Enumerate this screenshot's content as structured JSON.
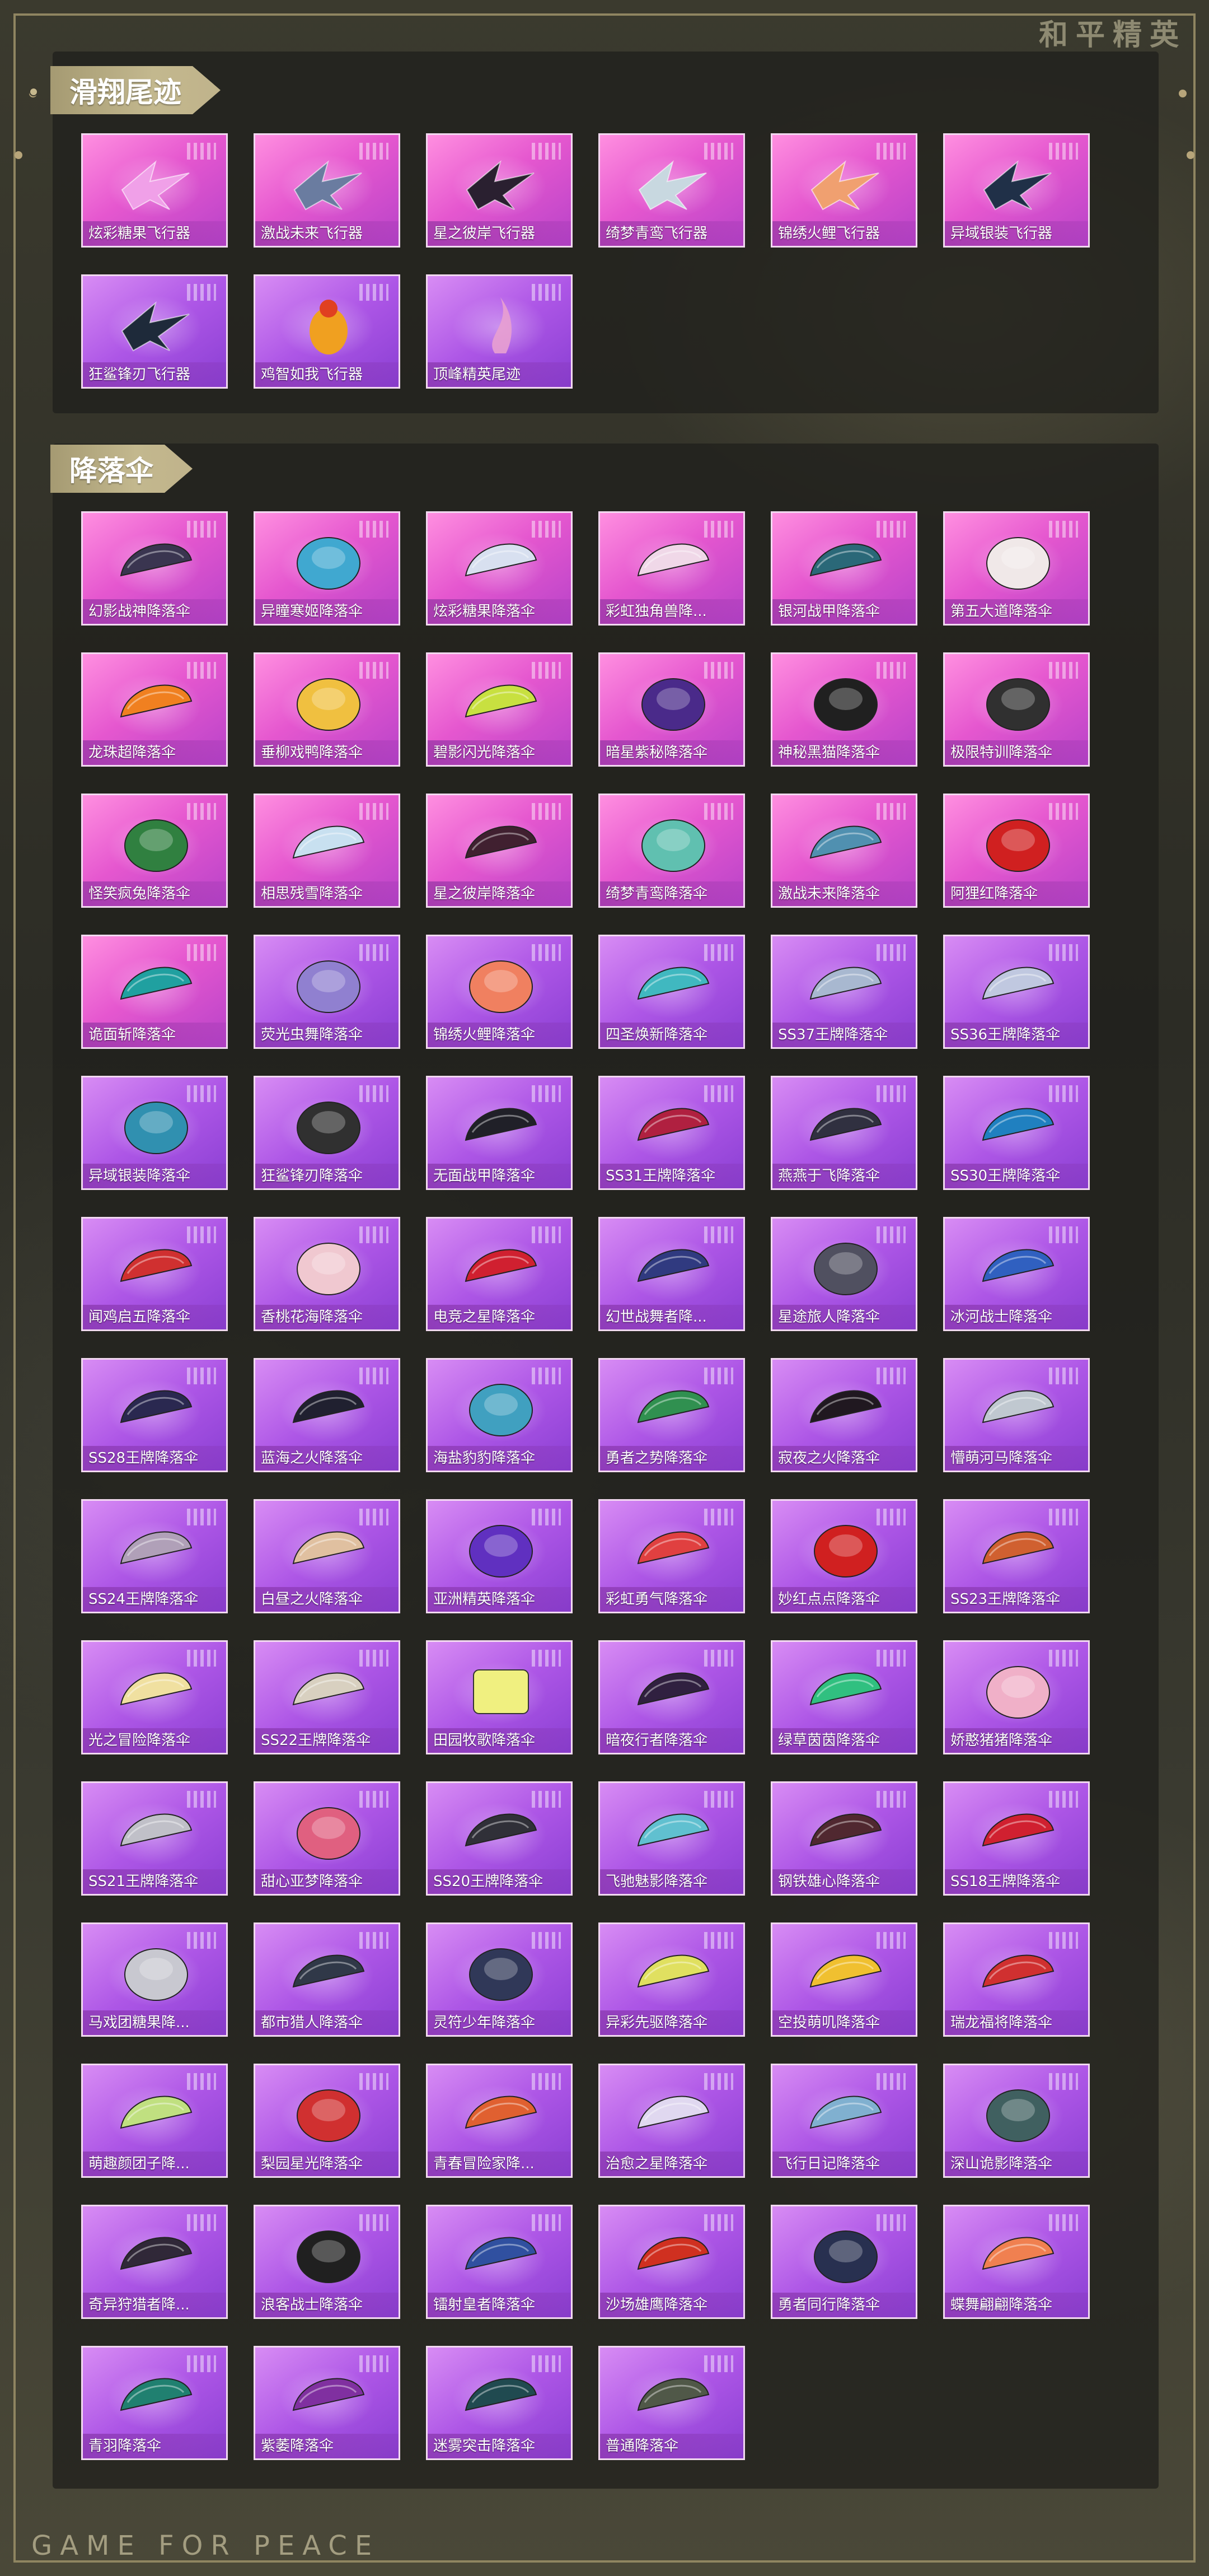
{
  "brand": "和平精英",
  "footer": "GAME FOR PEACE",
  "sections": [
    {
      "title": "滑翔尾迹",
      "items": [
        {
          "name": "炫彩糖果飞行器",
          "bg": "pink",
          "icon": "glider-icon",
          "color": "#f0a0e8"
        },
        {
          "name": "激战未来飞行器",
          "bg": "pink",
          "icon": "glider-icon",
          "color": "#6a7ca0"
        },
        {
          "name": "星之彼岸飞行器",
          "bg": "pink",
          "icon": "glider-icon",
          "color": "#2a2030"
        },
        {
          "name": "绮梦青鸾飞行器",
          "bg": "pink",
          "icon": "glider-icon",
          "color": "#c8d8e0"
        },
        {
          "name": "锦绣火鲤飞行器",
          "bg": "pink",
          "icon": "glider-icon",
          "color": "#f0a070"
        },
        {
          "name": "异域银装飞行器",
          "bg": "pink",
          "icon": "glider-icon",
          "color": "#203048"
        },
        {
          "name": "狂鲨锋刃飞行器",
          "bg": "purple",
          "icon": "shark-glider-icon",
          "color": "#1e2a3a"
        },
        {
          "name": "鸡智如我飞行器",
          "bg": "purple",
          "icon": "chicken-glider-icon",
          "color": "#f0a020"
        },
        {
          "name": "顶峰精英尾迹",
          "bg": "purple",
          "icon": "trail-icon",
          "color": "#e8a0d0"
        }
      ]
    },
    {
      "title": "降落伞",
      "items": [
        {
          "name": "幻影战神降落伞",
          "bg": "pink",
          "icon": "parachute-icon",
          "color": "#3a3550"
        },
        {
          "name": "异瞳寒姬降落伞",
          "bg": "pink",
          "icon": "parachute-round-icon",
          "color": "#40a8d0"
        },
        {
          "name": "炫彩糖果降落伞",
          "bg": "pink",
          "icon": "parachute-icon",
          "color": "#d8e0f0"
        },
        {
          "name": "彩虹独角兽降...",
          "bg": "pink",
          "icon": "parachute-icon",
          "color": "#f0d8e8"
        },
        {
          "name": "银河战甲降落伞",
          "bg": "pink",
          "icon": "parachute-icon",
          "color": "#2a6878"
        },
        {
          "name": "第五大道降落伞",
          "bg": "pink",
          "icon": "parachute-round-icon",
          "color": "#f0e8e8"
        },
        {
          "name": "龙珠超降落伞",
          "bg": "pink",
          "icon": "parachute-icon",
          "color": "#f08020"
        },
        {
          "name": "垂柳戏鸭降落伞",
          "bg": "pink",
          "icon": "parachute-round-icon",
          "color": "#f0c040"
        },
        {
          "name": "碧影闪光降落伞",
          "bg": "pink",
          "icon": "parachute-icon",
          "color": "#c8e040"
        },
        {
          "name": "暗星紫秘降落伞",
          "bg": "pink",
          "icon": "parachute-round-icon",
          "color": "#4a2a8a"
        },
        {
          "name": "神秘黑猫降落伞",
          "bg": "pink",
          "icon": "cat-parachute-icon",
          "color": "#202020"
        },
        {
          "name": "极限特训降落伞",
          "bg": "pink",
          "icon": "parachute-round-icon",
          "color": "#303030"
        },
        {
          "name": "怪笑疯兔降落伞",
          "bg": "pink",
          "icon": "parachute-round-icon",
          "color": "#308040"
        },
        {
          "name": "相思残雪降落伞",
          "bg": "pink",
          "icon": "parachute-icon",
          "color": "#c8e0f0"
        },
        {
          "name": "星之彼岸降落伞",
          "bg": "pink",
          "icon": "parachute-icon",
          "color": "#402030"
        },
        {
          "name": "绮梦青鸾降落伞",
          "bg": "pink",
          "icon": "parachute-round-icon",
          "color": "#60c0b0"
        },
        {
          "name": "激战未来降落伞",
          "bg": "pink",
          "icon": "parachute-icon",
          "color": "#5090b0"
        },
        {
          "name": "阿狸红降落伞",
          "bg": "pink",
          "icon": "parachute-round-icon",
          "color": "#d02020"
        },
        {
          "name": "诡面斩降落伞",
          "bg": "pink",
          "icon": "parachute-icon",
          "color": "#20a0a0"
        },
        {
          "name": "荧光虫舞降落伞",
          "bg": "purple",
          "icon": "flower-parachute-icon",
          "color": "#9080d0"
        },
        {
          "name": "锦绣火鲤降落伞",
          "bg": "purple",
          "icon": "parachute-round-icon",
          "color": "#f08060"
        },
        {
          "name": "四圣焕新降落伞",
          "bg": "purple",
          "icon": "parachute-icon",
          "color": "#40b8c0"
        },
        {
          "name": "SS37王牌降落伞",
          "bg": "purple",
          "icon": "parachute-icon",
          "color": "#a8b8d0"
        },
        {
          "name": "SS36王牌降落伞",
          "bg": "purple",
          "icon": "parachute-icon",
          "color": "#c0c8e0"
        },
        {
          "name": "异域银装降落伞",
          "bg": "purple",
          "icon": "parachute-round-icon",
          "color": "#3090b0"
        },
        {
          "name": "狂鲨锋刃降落伞",
          "bg": "purple",
          "icon": "parachute-round-icon",
          "color": "#303030"
        },
        {
          "name": "无面战甲降落伞",
          "bg": "purple",
          "icon": "parachute-icon",
          "color": "#202028"
        },
        {
          "name": "SS31王牌降落伞",
          "bg": "purple",
          "icon": "parachute-icon",
          "color": "#b02040"
        },
        {
          "name": "燕燕于飞降落伞",
          "bg": "purple",
          "icon": "parachute-icon",
          "color": "#303040"
        },
        {
          "name": "SS30王牌降落伞",
          "bg": "purple",
          "icon": "parachute-icon",
          "color": "#2080c0"
        },
        {
          "name": "闻鸡启五降落伞",
          "bg": "purple",
          "icon": "parachute-icon",
          "color": "#d03030"
        },
        {
          "name": "香桃花海降落伞",
          "bg": "purple",
          "icon": "parachute-round-icon",
          "color": "#f0c8d0"
        },
        {
          "name": "电竞之星降落伞",
          "bg": "purple",
          "icon": "parachute-icon",
          "color": "#d02030"
        },
        {
          "name": "幻世战舞者降...",
          "bg": "purple",
          "icon": "parachute-icon",
          "color": "#303a80"
        },
        {
          "name": "星途旅人降落伞",
          "bg": "purple",
          "icon": "parachute-round-icon",
          "color": "#505060"
        },
        {
          "name": "冰河战士降落伞",
          "bg": "purple",
          "icon": "parachute-icon",
          "color": "#3060c0"
        },
        {
          "name": "SS28王牌降落伞",
          "bg": "purple",
          "icon": "parachute-icon",
          "color": "#2a2850"
        },
        {
          "name": "蓝海之火降落伞",
          "bg": "purple",
          "icon": "parachute-icon",
          "color": "#202030"
        },
        {
          "name": "海盐豹豹降落伞",
          "bg": "purple",
          "icon": "parachute-round-icon",
          "color": "#40a0c0"
        },
        {
          "name": "勇者之势降落伞",
          "bg": "purple",
          "icon": "parachute-icon",
          "color": "#309050"
        },
        {
          "name": "寂夜之火降落伞",
          "bg": "purple",
          "icon": "parachute-icon",
          "color": "#201820"
        },
        {
          "name": "懵萌河马降落伞",
          "bg": "purple",
          "icon": "parachute-icon",
          "color": "#c0c8d0"
        },
        {
          "name": "SS24王牌降落伞",
          "bg": "purple",
          "icon": "parachute-icon",
          "color": "#b0a0b8"
        },
        {
          "name": "白昼之火降落伞",
          "bg": "purple",
          "icon": "parachute-icon",
          "color": "#e0c0a0"
        },
        {
          "name": "亚洲精英降落伞",
          "bg": "purple",
          "icon": "parachute-round-icon",
          "color": "#6030c0"
        },
        {
          "name": "彩虹勇气降落伞",
          "bg": "purple",
          "icon": "rainbow-parachute-icon",
          "color": "#e04040"
        },
        {
          "name": "妙红点点降落伞",
          "bg": "purple",
          "icon": "ladybug-parachute-icon",
          "color": "#d02020"
        },
        {
          "name": "SS23王牌降落伞",
          "bg": "purple",
          "icon": "parachute-icon",
          "color": "#d06030"
        },
        {
          "name": "光之冒险降落伞",
          "bg": "purple",
          "icon": "parachute-icon",
          "color": "#f0e0a0"
        },
        {
          "name": "SS22王牌降落伞",
          "bg": "purple",
          "icon": "parachute-icon",
          "color": "#d8d0c0"
        },
        {
          "name": "田园牧歌降落伞",
          "bg": "purple",
          "icon": "parachute-square-icon",
          "color": "#f0f080"
        },
        {
          "name": "暗夜行者降落伞",
          "bg": "purple",
          "icon": "parachute-icon",
          "color": "#302040"
        },
        {
          "name": "绿草茵茵降落伞",
          "bg": "purple",
          "icon": "parachute-icon",
          "color": "#30c080"
        },
        {
          "name": "娇憨猪猪降落伞",
          "bg": "purple",
          "icon": "parachute-round-icon",
          "color": "#f0b0c8"
        },
        {
          "name": "SS21王牌降落伞",
          "bg": "purple",
          "icon": "parachute-icon",
          "color": "#c0c0c8"
        },
        {
          "name": "甜心亚梦降落伞",
          "bg": "purple",
          "icon": "parachute-round-icon",
          "color": "#e06080"
        },
        {
          "name": "SS20王牌降落伞",
          "bg": "purple",
          "icon": "parachute-icon",
          "color": "#303038"
        },
        {
          "name": "飞驰魅影降落伞",
          "bg": "purple",
          "icon": "parachute-icon",
          "color": "#60c0d0"
        },
        {
          "name": "钢铁雄心降落伞",
          "bg": "purple",
          "icon": "parachute-icon",
          "color": "#502830"
        },
        {
          "name": "SS18王牌降落伞",
          "bg": "purple",
          "icon": "parachute-icon",
          "color": "#d02030"
        },
        {
          "name": "马戏团糖果降...",
          "bg": "purple",
          "icon": "parachute-round-icon",
          "color": "#c8c8d0"
        },
        {
          "name": "都市猎人降落伞",
          "bg": "purple",
          "icon": "parachute-icon",
          "color": "#303848"
        },
        {
          "name": "灵符少年降落伞",
          "bg": "purple",
          "icon": "parachute-round-icon",
          "color": "#303858"
        },
        {
          "name": "异彩先驱降落伞",
          "bg": "purple",
          "icon": "parachute-icon",
          "color": "#e0e060"
        },
        {
          "name": "空投萌叽降落伞",
          "bg": "purple",
          "icon": "parachute-icon",
          "color": "#f0c030"
        },
        {
          "name": "瑞龙福将降落伞",
          "bg": "purple",
          "icon": "parachute-icon",
          "color": "#d03030"
        },
        {
          "name": "萌趣颜团子降...",
          "bg": "purple",
          "icon": "parachute-icon",
          "color": "#c0e080"
        },
        {
          "name": "梨园星光降落伞",
          "bg": "purple",
          "icon": "parachute-round-icon",
          "color": "#d03030"
        },
        {
          "name": "青春冒险家降...",
          "bg": "purple",
          "icon": "parachute-icon",
          "color": "#e06030"
        },
        {
          "name": "治愈之星降落伞",
          "bg": "purple",
          "icon": "parachute-icon",
          "color": "#e0d8f0"
        },
        {
          "name": "飞行日记降落伞",
          "bg": "purple",
          "icon": "parachute-icon",
          "color": "#80b0d0"
        },
        {
          "name": "深山诡影降落伞",
          "bg": "purple",
          "icon": "parachute-round-icon",
          "color": "#406060"
        },
        {
          "name": "奇异狩猎者降...",
          "bg": "purple",
          "icon": "parachute-icon",
          "color": "#302838"
        },
        {
          "name": "浪客战士降落伞",
          "bg": "purple",
          "icon": "parachute-round-icon",
          "color": "#202020"
        },
        {
          "name": "镭射皇者降落伞",
          "bg": "purple",
          "icon": "parachute-icon",
          "color": "#3050a0"
        },
        {
          "name": "沙场雄鹰降落伞",
          "bg": "purple",
          "icon": "parachute-icon",
          "color": "#d03020"
        },
        {
          "name": "勇者同行降落伞",
          "bg": "purple",
          "icon": "parachute-round-icon",
          "color": "#283050"
        },
        {
          "name": "蝶舞翩翩降落伞",
          "bg": "purple",
          "icon": "parachute-icon",
          "color": "#f08050"
        },
        {
          "name": "青羽降落伞",
          "bg": "purple",
          "icon": "parachute-icon",
          "color": "#208070"
        },
        {
          "name": "紫萎降落伞",
          "bg": "purple",
          "icon": "parachute-icon",
          "color": "#8030a0"
        },
        {
          "name": "迷雾突击降落伞",
          "bg": "purple",
          "icon": "parachute-icon",
          "color": "#204a50"
        },
        {
          "name": "普通降落伞",
          "bg": "purple",
          "icon": "parachute-icon",
          "color": "#505848"
        }
      ]
    }
  ]
}
